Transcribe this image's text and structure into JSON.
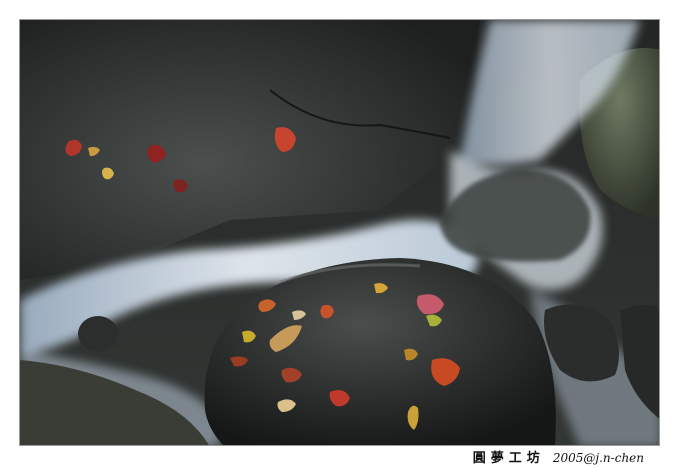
{
  "caption": {
    "studio": "圓夢工坊",
    "credit": "2005@j.n-chen"
  },
  "photo": {
    "subject": "stream"
  }
}
